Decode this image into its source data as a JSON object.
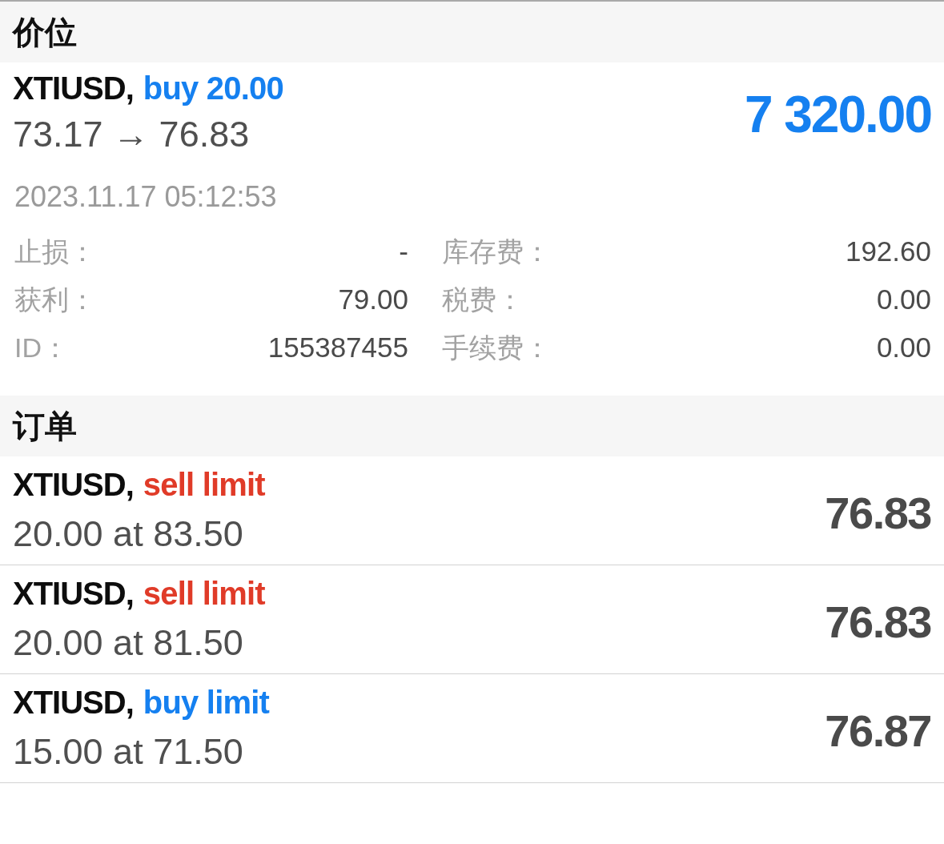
{
  "positions_header": {
    "title": "价位"
  },
  "positions": [
    {
      "symbol": "XTIUSD,",
      "action": "buy 20.00",
      "color": "#1580f0",
      "prices": "73.17 → 76.83",
      "profit": "7 320.00",
      "time": "2023.11.17 05:12:53",
      "details": [
        {
          "label": "止损：",
          "value": "-"
        },
        {
          "label": "库存费：",
          "value": "192.60"
        },
        {
          "label": "获利：",
          "value": "79.00"
        },
        {
          "label": "税费：",
          "value": "0.00"
        },
        {
          "label": "ID：",
          "value": "155387455"
        },
        {
          "label": "手续费：",
          "value": "0.00"
        }
      ]
    }
  ],
  "orders_header": {
    "title": "订单"
  },
  "orders": [
    {
      "symbol": "XTIUSD,",
      "action": "sell limit",
      "color": "#e03b28",
      "detail": "20.00 at 83.50",
      "price": "76.83"
    },
    {
      "symbol": "XTIUSD,",
      "action": "sell limit",
      "color": "#e03b28",
      "detail": "20.00 at 81.50",
      "price": "76.83"
    },
    {
      "symbol": "XTIUSD,",
      "action": "buy limit",
      "color": "#1580f0",
      "detail": "15.00 at 71.50",
      "price": "76.87"
    }
  ]
}
